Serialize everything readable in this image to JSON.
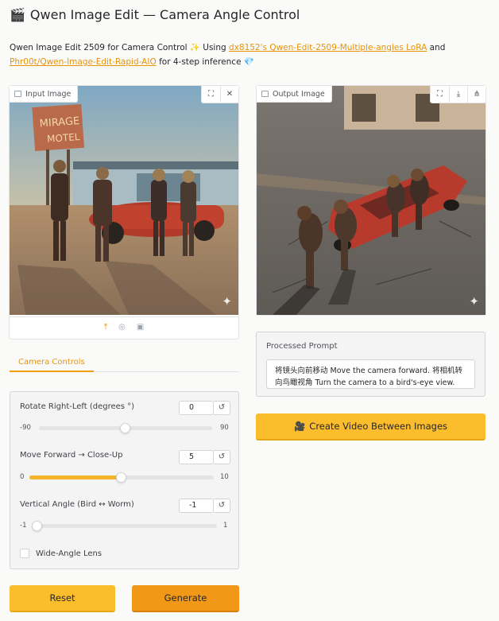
{
  "app": {
    "title": "Qwen Image Edit — Camera Angle Control",
    "title_icon": "🎬",
    "description": {
      "prefix": "Qwen Image Edit 2509 for Camera Control ✨ Using ",
      "link1": "dx8152's Qwen-Edit-2509-Multiple-angles LoRA",
      "middle": " and ",
      "link2": "Phr00t/Qwen-Image-Edit-Rapid-AIO",
      "suffix": " for 4-step inference 💎"
    }
  },
  "input_image": {
    "label": "Input Image"
  },
  "output_image": {
    "label": "Output Image"
  },
  "tabs": [
    {
      "label": "Camera Controls"
    }
  ],
  "controls": {
    "rotate": {
      "label": "Rotate Right-Left (degrees °)",
      "value": "0",
      "min": "-90",
      "max": "90",
      "fraction": 0.5
    },
    "forward": {
      "label": "Move Forward → Close-Up",
      "value": "5",
      "min": "0",
      "max": "10",
      "fraction": 0.5
    },
    "vertical": {
      "label": "Vertical Angle (Bird ↔ Worm)",
      "value": "-1",
      "min": "-1",
      "max": "1",
      "fraction": 0.0
    },
    "wide_angle": {
      "label": "Wide-Angle Lens",
      "checked": false
    }
  },
  "buttons": {
    "reset": "Reset",
    "generate": "Generate",
    "video": "Create Video Between Images",
    "video_icon": "🎥"
  },
  "prompt": {
    "title": "Processed Prompt",
    "text": "将镜头向前移动 Move the camera forward. 将相机转向鸟瞰视角 Turn the camera to a bird's-eye view."
  },
  "colors": {
    "accent": "#f59e0b",
    "link": "#e8930c",
    "button_primary": "#fbbd2c",
    "button_generate": "#f29818"
  }
}
